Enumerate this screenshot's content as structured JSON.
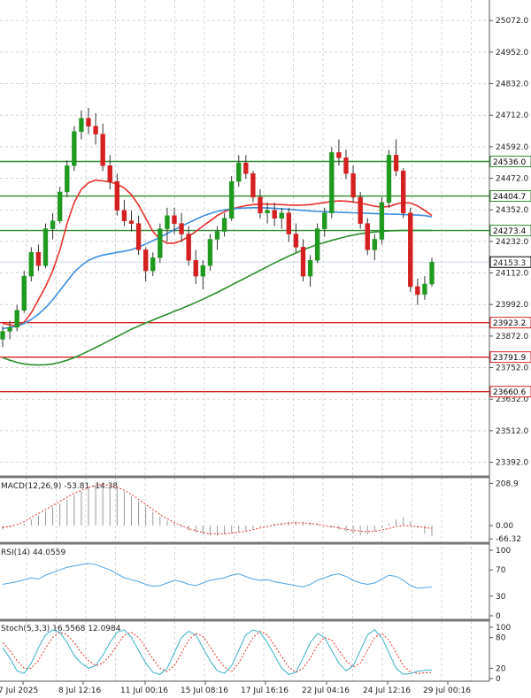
{
  "chart_data": {
    "type": "candlestick",
    "main": {
      "y_axis_labels": [
        "25072.0",
        "24952.0",
        "24832.0",
        "24712.0",
        "24592.0",
        "24472.0",
        "24352.0",
        "24232.0",
        "24112.0",
        "23992.0",
        "23872.0",
        "23752.0",
        "23632.0",
        "23512.0",
        "23392.0"
      ],
      "ylim": [
        23340,
        25150
      ],
      "current_price": {
        "label": "24153.3",
        "value": 24153.3
      },
      "resistance_levels": [
        {
          "label": "24536.0",
          "value": 24536.0,
          "color": "#2e8b2e"
        },
        {
          "label": "24404.7",
          "value": 24404.7,
          "color": "#2e8b2e"
        },
        {
          "label": "24273.4",
          "value": 24273.4,
          "color": "#2e8b2e"
        }
      ],
      "support_levels": [
        {
          "label": "23923.2",
          "value": 23923.2,
          "color": "#d42020"
        },
        {
          "label": "23791.9",
          "value": 23791.9,
          "color": "#d42020"
        },
        {
          "label": "23660.6",
          "value": 23660.6,
          "color": "#d42020"
        }
      ],
      "candles": [
        [
          23860,
          23910,
          23830,
          23890
        ],
        [
          23890,
          23930,
          23860,
          23905
        ],
        [
          23905,
          23990,
          23890,
          23970
        ],
        [
          23970,
          24120,
          23960,
          24100
        ],
        [
          24100,
          24210,
          24080,
          24190
        ],
        [
          24190,
          24220,
          24120,
          24140
        ],
        [
          24140,
          24300,
          24130,
          24280
        ],
        [
          24280,
          24340,
          24240,
          24310
        ],
        [
          24310,
          24440,
          24300,
          24420
        ],
        [
          24420,
          24540,
          24400,
          24520
        ],
        [
          24520,
          24670,
          24500,
          24650
        ],
        [
          24650,
          24730,
          24620,
          24700
        ],
        [
          24700,
          24740,
          24640,
          24670
        ],
        [
          24670,
          24720,
          24600,
          24640
        ],
        [
          24640,
          24680,
          24500,
          24520
        ],
        [
          24520,
          24560,
          24430,
          24460
        ],
        [
          24460,
          24490,
          24330,
          24350
        ],
        [
          24350,
          24390,
          24290,
          24310
        ],
        [
          24310,
          24350,
          24270,
          24300
        ],
        [
          24300,
          24330,
          24180,
          24200
        ],
        [
          24200,
          24210,
          24080,
          24120
        ],
        [
          24120,
          24190,
          24100,
          24170
        ],
        [
          24170,
          24300,
          24150,
          24280
        ],
        [
          24280,
          24360,
          24230,
          24330
        ],
        [
          24330,
          24360,
          24260,
          24300
        ],
        [
          24300,
          24340,
          24230,
          24260
        ],
        [
          24260,
          24290,
          24140,
          24160
        ],
        [
          24160,
          24200,
          24070,
          24100
        ],
        [
          24100,
          24160,
          24050,
          24140
        ],
        [
          24140,
          24260,
          24120,
          24240
        ],
        [
          24240,
          24290,
          24200,
          24270
        ],
        [
          24270,
          24340,
          24250,
          24320
        ],
        [
          24320,
          24480,
          24310,
          24460
        ],
        [
          24460,
          24560,
          24440,
          24530
        ],
        [
          24530,
          24560,
          24470,
          24490
        ],
        [
          24490,
          24500,
          24380,
          24400
        ],
        [
          24400,
          24430,
          24320,
          24340
        ],
        [
          24340,
          24380,
          24300,
          24350
        ],
        [
          24350,
          24380,
          24290,
          24320
        ],
        [
          24320,
          24360,
          24280,
          24340
        ],
        [
          24340,
          24360,
          24230,
          24260
        ],
        [
          24260,
          24300,
          24190,
          24210
        ],
        [
          24210,
          24240,
          24080,
          24100
        ],
        [
          24100,
          24180,
          24060,
          24160
        ],
        [
          24160,
          24300,
          24150,
          24280
        ],
        [
          24280,
          24360,
          24250,
          24340
        ],
        [
          24340,
          24590,
          24320,
          24570
        ],
        [
          24570,
          24620,
          24520,
          24550
        ],
        [
          24550,
          24580,
          24470,
          24490
        ],
        [
          24490,
          24520,
          24380,
          24400
        ],
        [
          24400,
          24420,
          24280,
          24300
        ],
        [
          24300,
          24320,
          24180,
          24200
        ],
        [
          24200,
          24260,
          24160,
          24240
        ],
        [
          24240,
          24400,
          24220,
          24380
        ],
        [
          24380,
          24580,
          24360,
          24560
        ],
        [
          24560,
          24620,
          24480,
          24500
        ],
        [
          24500,
          24510,
          24320,
          24340
        ],
        [
          24340,
          24360,
          24040,
          24060
        ],
        [
          24060,
          24090,
          23990,
          24030
        ],
        [
          24030,
          24100,
          24010,
          24070
        ],
        [
          24070,
          24170,
          24060,
          24153.3
        ]
      ],
      "indicator_lines": [
        {
          "name": "red",
          "color": "#e8302a",
          "values": [
            23920,
            23915,
            23910,
            23925,
            23960,
            24010,
            24060,
            24120,
            24200,
            24300,
            24380,
            24430,
            24455,
            24465,
            24462,
            24458,
            24450,
            24435,
            24410,
            24370,
            24320,
            24270,
            24240,
            24225,
            24225,
            24235,
            24250,
            24270,
            24290,
            24310,
            24330,
            24345,
            24355,
            24362,
            24368,
            24372,
            24374,
            24374,
            24373,
            24372,
            24370,
            24369,
            24370,
            24372,
            24376,
            24380,
            24384,
            24386,
            24385,
            24382,
            24378,
            24372,
            24366,
            24362,
            24365,
            24374,
            24380,
            24378,
            24367,
            24350,
            24330
          ]
        },
        {
          "name": "blue",
          "color": "#3c8ee0",
          "values": [
            23900,
            23905,
            23910,
            23920,
            23935,
            23955,
            23980,
            24010,
            24045,
            24080,
            24115,
            24140,
            24160,
            24172,
            24180,
            24185,
            24190,
            24195,
            24200,
            24210,
            24222,
            24235,
            24248,
            24262,
            24276,
            24290,
            24303,
            24316,
            24328,
            24338,
            24346,
            24352,
            24356,
            24358,
            24359,
            24360,
            24360,
            24359,
            24358,
            24356,
            24354,
            24352,
            24350,
            24348,
            24346,
            24345,
            24344,
            24343,
            24342,
            24341,
            24340,
            24339,
            24338,
            24337,
            24336,
            24335,
            24334,
            24333,
            24332,
            24330,
            24325
          ]
        },
        {
          "name": "green",
          "color": "#2a8f2a",
          "values": [
            23790,
            23780,
            23772,
            23766,
            23763,
            23762,
            23763,
            23766,
            23772,
            23780,
            23790,
            23802,
            23815,
            23828,
            23842,
            23856,
            23870,
            23884,
            23898,
            23910,
            23922,
            23933,
            23944,
            23955,
            23966,
            23977,
            23988,
            24000,
            24012,
            24025,
            24038,
            24052,
            24066,
            24080,
            24094,
            24108,
            24122,
            24136,
            24150,
            24163,
            24176,
            24188,
            24200,
            24210,
            24220,
            24228,
            24236,
            24243,
            24250,
            24256,
            24261,
            24265,
            24268,
            24270,
            24272,
            24273,
            24274,
            24274,
            24274,
            24274,
            24274
          ]
        }
      ]
    },
    "macd": {
      "label": "MACD(12,26,9) -53.81 -14.38",
      "y_axis_labels": [
        "208.9",
        "0.00",
        "-66.32"
      ],
      "histogram": [
        -20,
        -10,
        0,
        10,
        30,
        50,
        70,
        90,
        110,
        130,
        150,
        170,
        185,
        200,
        208,
        200,
        190,
        170,
        145,
        120,
        95,
        70,
        45,
        25,
        10,
        -10,
        -25,
        -35,
        -45,
        -50,
        -50,
        -45,
        -40,
        -35,
        -25,
        -15,
        -5,
        0,
        10,
        15,
        20,
        22,
        20,
        15,
        10,
        0,
        -10,
        -20,
        -30,
        -40,
        -50,
        -45,
        -30,
        -10,
        10,
        30,
        40,
        20,
        -10,
        -40,
        -53.81
      ],
      "signal": [
        -10,
        -5,
        5,
        20,
        40,
        60,
        80,
        100,
        120,
        140,
        160,
        175,
        190,
        200,
        205,
        200,
        190,
        175,
        155,
        130,
        105,
        80,
        55,
        35,
        15,
        0,
        -15,
        -25,
        -35,
        -40,
        -42,
        -40,
        -37,
        -33,
        -28,
        -20,
        -12,
        -5,
        2,
        8,
        12,
        14,
        13,
        10,
        6,
        0,
        -6,
        -12,
        -18,
        -24,
        -28,
        -30,
        -28,
        -22,
        -14,
        -6,
        0,
        -2,
        -6,
        -10,
        -14.38
      ],
      "ylim": [
        -70,
        220
      ]
    },
    "rsi": {
      "label": "RSI(14) 44.0559",
      "y_axis_labels": [
        "100",
        "70",
        "30",
        "0"
      ],
      "values": [
        48,
        50,
        52,
        55,
        58,
        56,
        62,
        66,
        70,
        74,
        76,
        78,
        80,
        78,
        74,
        70,
        64,
        58,
        55,
        52,
        48,
        45,
        46,
        50,
        54,
        52,
        48,
        46,
        50,
        54,
        56,
        58,
        62,
        64,
        60,
        56,
        54,
        55,
        52,
        50,
        48,
        46,
        44,
        48,
        54,
        58,
        62,
        64,
        60,
        54,
        50,
        48,
        50,
        56,
        62,
        60,
        54,
        46,
        42,
        43,
        44.0559
      ],
      "ylim": [
        0,
        100
      ]
    },
    "stoch": {
      "label": "Stoch(5,3,3) 16.5568 12.0984",
      "y_axis_labels": [
        "100",
        "80",
        "20",
        "0"
      ],
      "k": [
        60,
        40,
        15,
        10,
        30,
        60,
        85,
        95,
        90,
        70,
        45,
        30,
        20,
        25,
        45,
        70,
        90,
        95,
        80,
        55,
        30,
        12,
        8,
        20,
        50,
        80,
        92,
        85,
        60,
        35,
        15,
        10,
        25,
        55,
        85,
        95,
        90,
        70,
        45,
        20,
        8,
        12,
        40,
        70,
        88,
        80,
        55,
        30,
        15,
        25,
        55,
        85,
        95,
        80,
        50,
        20,
        8,
        10,
        14,
        16,
        16.5568
      ],
      "d": [
        70,
        55,
        35,
        20,
        20,
        35,
        60,
        80,
        90,
        85,
        70,
        50,
        35,
        25,
        30,
        45,
        65,
        85,
        90,
        80,
        60,
        38,
        20,
        14,
        25,
        50,
        75,
        88,
        82,
        62,
        40,
        22,
        14,
        30,
        55,
        80,
        92,
        85,
        65,
        42,
        22,
        12,
        20,
        40,
        65,
        80,
        75,
        55,
        35,
        22,
        30,
        55,
        80,
        88,
        75,
        50,
        25,
        12,
        10,
        11,
        12.0984
      ],
      "ylim": [
        0,
        100
      ]
    },
    "x_axis_labels": [
      "7 Jul 2025",
      "8 Jul 12:16",
      "11 Jul 00:16",
      "15 Jul 08:16",
      "17 Jul 16:16",
      "22 Jul 04:16",
      "24 Jul 12:16",
      "29 Jul 00:16"
    ]
  },
  "colors": {
    "bull": "#1f9a1f",
    "bear": "#d42020",
    "grid": "#d4d4d4",
    "panel_border": "#777777",
    "macd_signal": "#e8302a",
    "rsi_line": "#4aa3e8",
    "stoch_k": "#38b2c8",
    "stoch_d": "#e8302a"
  }
}
